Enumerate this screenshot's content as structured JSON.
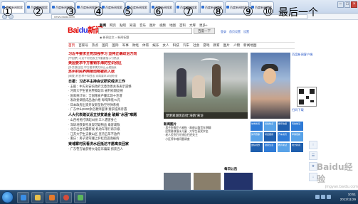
{
  "browser": {
    "tabs": [
      {
        "label": "百度新闻搜索"
      },
      {
        "label": "百度新闻搜索"
      },
      {
        "label": "百度新闻搜索"
      },
      {
        "label": "百度新闻搜索"
      },
      {
        "label": "百度新闻搜索"
      },
      {
        "label": "百度新闻搜索"
      },
      {
        "label": "百度新闻搜索"
      },
      {
        "label": "百度新闻搜索"
      },
      {
        "label": "百度新闻搜索"
      },
      {
        "label": "百度新闻搜索"
      },
      {
        "label": "百度新闻搜索"
      }
    ],
    "address": "news.baidu.com",
    "win_min": "–",
    "win_max": "□",
    "win_close": "×"
  },
  "annotations": {
    "numbers": [
      "①",
      "②",
      "③",
      "④",
      "⑤",
      "⑥",
      "⑦",
      "⑧",
      "⑨",
      "⑩"
    ],
    "last_label": "最后一个"
  },
  "baidu": {
    "logo_text": "Bai",
    "logo_paw": "du",
    "logo_suffix": "新闻",
    "top_tabs": [
      "新闻",
      "网页",
      "贴吧",
      "知道",
      "音乐",
      "图片",
      "视频",
      "地图",
      "百科",
      "文库",
      "更多»"
    ],
    "search_button": "百度一下",
    "radio_news": "新闻全文",
    "radio_title": "新闻标题",
    "user_links": [
      "登录",
      "首页设置",
      "设置"
    ],
    "channels": [
      "首页",
      "百家号",
      "热点",
      "国内",
      "国际",
      "军事",
      "财经",
      "体育",
      "娱乐",
      "女人",
      "科技",
      "汽车",
      "社会",
      "游戏",
      "教育",
      "图片",
      "人物",
      "新闻地图"
    ],
    "left_news": [
      {
        "text": "习近平要求全党加强学习 坚持正确政治方向",
        "style": "hl"
      },
      {
        "text": "[中国梦] 习近平对民族工作重要指示引热议",
        "style": "sub"
      },
      {
        "text": "美国要求中方撤销东海防空识别区",
        "style": "hl"
      },
      {
        "text": "[外交部回应] 中方要求美方停止无理指责",
        "style": "sub"
      },
      {
        "text": "苏州村民养两栖动物被抓入狱",
        "style": "hl"
      },
      {
        "text": "[调查] 村民称不知违法 家属要求从轻处理",
        "style": "sub"
      },
      {
        "text": "日报：习近平主持会议研究经济工作",
        "style": "sec"
      },
      {
        "text": "· 王毅：中方对安倍政府无意改善关系表示遗憾",
        "style": ""
      },
      {
        "text": "· 河南大学生冒充警察敲诈 被判有期徒刑",
        "style": ""
      },
      {
        "text": "· 国家统计局：全国粮食产量实现十连增",
        "style": ""
      },
      {
        "text": "· 发改委调低成品油价格 每吨降低70元",
        "style": ""
      },
      {
        "text": "· 日本政府出资开发新型防空导弹系统",
        "style": ""
      },
      {
        "text": "· 广东中山2000余名教师罢课 要求提高待遇",
        "style": ""
      },
      {
        "text": "人大代表建议设立扶贫基金 破解\"水困\"难题",
        "style": "sec"
      },
      {
        "text": "· 山西村民打牌起纠纷 三人遇害身亡",
        "style": ""
      },
      {
        "text": "· 深圳地铁安检发现可疑物品 乘客疏散",
        "style": ""
      },
      {
        "text": "· 北京出台治霾新规 机动车限行再升级",
        "style": ""
      },
      {
        "text": "· 江苏大学生支教山区 坚持五年不放弃",
        "style": ""
      },
      {
        "text": "· 重庆：男子酒驾撞上护栏后逃逸被拘",
        "style": ""
      },
      {
        "text": "柬埔寨村民看洪水后抵达不愿离去回家",
        "style": "sec"
      },
      {
        "text": "· 广东警方破获特大电信诈骗案 抓获百人",
        "style": ""
      }
    ],
    "photo_caption": "昆明翠湖现首批\"海鸥\"来访",
    "hot_title": "新闻图片",
    "hot_list": [
      "· 男子扮鬼吓人被拘 · 高速公路货车侧翻",
      "· 民警勇救落水儿童 · 大学生获奖学金",
      "· 老人捡到万元钱包归还失主",
      "· 小区停车难问题调查"
    ],
    "side_links": [
      "百度新闻客户端",
      "扫码下载",
      "热门搜索"
    ],
    "tiles": [
      "城市新闻",
      "社会热点",
      "娱乐快报",
      "科技前沿",
      "体育赛事",
      "财经要闻",
      "汽车资讯",
      "军事观察",
      "国际视野",
      "健康生活",
      "教育考试",
      "地方新闻"
    ],
    "bottom_left_title": "视频新闻",
    "bottom_right_title": "每日公告",
    "sidebar_icons": [
      "↑",
      "☰",
      "★",
      "↓"
    ]
  },
  "taskbar": {
    "time": "10:51",
    "date": "2013/11/29"
  },
  "watermark": {
    "main": "Baidu经验",
    "sub": "jingyan.baidu.com"
  },
  "colors": {
    "accent_red": "#c00000",
    "baidu_blue": "#2932e1",
    "link_blue": "#2a59c7"
  }
}
